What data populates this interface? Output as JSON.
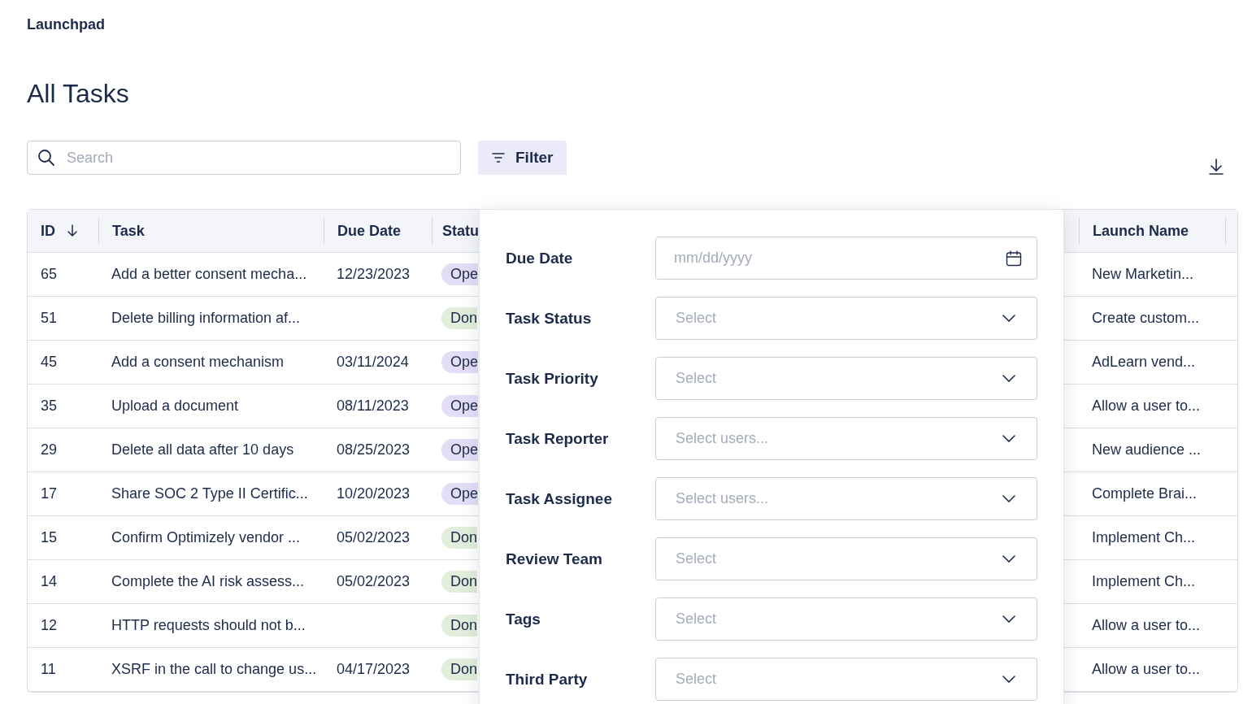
{
  "app": {
    "name": "Launchpad"
  },
  "page": {
    "title": "All Tasks"
  },
  "search": {
    "placeholder": "Search"
  },
  "filter_button": {
    "label": "Filter"
  },
  "table": {
    "columns": [
      {
        "label": "ID",
        "sorted": true
      },
      {
        "label": "Task",
        "sorted": false
      },
      {
        "label": "Due Date",
        "sorted": false
      },
      {
        "label": "Statu"
      },
      {
        "label": "Launch Name",
        "sorted": false
      }
    ],
    "rows": [
      {
        "id": "65",
        "task": "Add a better consent mecha...",
        "due": "12/23/2023",
        "status": "Ope",
        "kind": "open",
        "launch": "New Marketin..."
      },
      {
        "id": "51",
        "task": "Delete billing information af...",
        "due": "",
        "status": "Don",
        "kind": "done",
        "launch": "Create custom..."
      },
      {
        "id": "45",
        "task": "Add a consent mechanism",
        "due": "03/11/2024",
        "status": "Ope",
        "kind": "open",
        "launch": "AdLearn vend..."
      },
      {
        "id": "35",
        "task": "Upload a document",
        "due": "08/11/2023",
        "status": "Ope",
        "kind": "open",
        "launch": "Allow a user to..."
      },
      {
        "id": "29",
        "task": "Delete all data after 10 days",
        "due": "08/25/2023",
        "status": "Ope",
        "kind": "open",
        "launch": "New audience ..."
      },
      {
        "id": "17",
        "task": "Share SOC 2 Type II Certific...",
        "due": "10/20/2023",
        "status": "Ope",
        "kind": "open",
        "launch": "Complete Brai..."
      },
      {
        "id": "15",
        "task": "Confirm Optimizely vendor ...",
        "due": "05/02/2023",
        "status": "Don",
        "kind": "done",
        "launch": "Implement Ch..."
      },
      {
        "id": "14",
        "task": "Complete the AI risk assess...",
        "due": "05/02/2023",
        "status": "Don",
        "kind": "done",
        "launch": "Implement Ch..."
      },
      {
        "id": "12",
        "task": "HTTP requests should not b...",
        "due": "",
        "status": "Don",
        "kind": "done",
        "launch": "Allow a user to..."
      },
      {
        "id": "11",
        "task": "XSRF in the call to change us...",
        "due": "04/17/2023",
        "status": "Don",
        "kind": "done",
        "launch": "Allow a user to..."
      }
    ]
  },
  "filter_panel": {
    "fields": [
      {
        "label": "Due Date",
        "kind": "date",
        "placeholder": "mm/dd/yyyy"
      },
      {
        "label": "Task Status",
        "kind": "select",
        "placeholder": "Select"
      },
      {
        "label": "Task Priority",
        "kind": "select",
        "placeholder": "Select"
      },
      {
        "label": "Task Reporter",
        "kind": "select",
        "placeholder": "Select users..."
      },
      {
        "label": "Task Assignee",
        "kind": "select",
        "placeholder": "Select users..."
      },
      {
        "label": "Review Team",
        "kind": "select",
        "placeholder": "Select"
      },
      {
        "label": "Tags",
        "kind": "select",
        "placeholder": "Select"
      },
      {
        "label": "Third Party",
        "kind": "select",
        "placeholder": "Select"
      }
    ]
  }
}
